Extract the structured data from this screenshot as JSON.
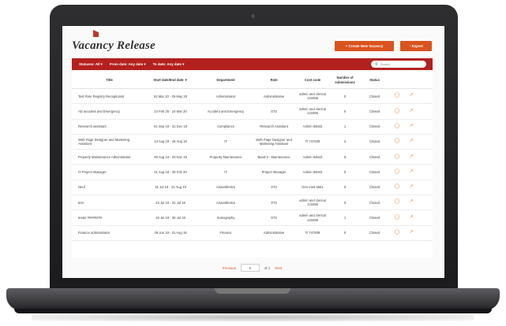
{
  "page": {
    "title": "Vacancy Release",
    "create_button": "+ Create New Vacancy",
    "export_button": "↑ Export"
  },
  "filters": {
    "status": "Statuses: All ▾",
    "from_date": "From date: Any date ▾",
    "to_date": "To date: Any date ▾",
    "search_placeholder": "Search"
  },
  "table": {
    "headers": [
      "Title",
      "Start date/End date ▼",
      "Department",
      "Role",
      "Cost code",
      "Number of submissions",
      "Status"
    ],
    "rows": [
      {
        "title": "Test Role Registry Receptionist",
        "dates": "02 Mar 20 - 29 May 20",
        "department": "Administrator",
        "role": "Administrative",
        "cost_code": "admin and clerical 123456",
        "submissions": "0",
        "status": "Closed"
      },
      {
        "title": "AD accident and Emergency",
        "dates": "24 Feb 20 - 24 Mar 20",
        "department": "Accident and Emergency",
        "role": "ST2",
        "cost_code": "admin and clerical 123456",
        "submissions": "0",
        "status": "Closed"
      },
      {
        "title": "Research assistant",
        "dates": "01 Sep 19 - 31 Dec 19",
        "department": "Compliance",
        "role": "Research Assistant",
        "cost_code": "Admin 84843",
        "submissions": "1",
        "status": "Closed"
      },
      {
        "title": "Web Page Designer and Marketing Assistant",
        "dates": "13 Aug 19 - 26 Aug 19",
        "department": "IT",
        "role": "Web Page Designer and Marketing Assistant",
        "cost_code": "IT 747839",
        "submissions": "2",
        "status": "Closed"
      },
      {
        "title": "Property Maintenance Administrator",
        "dates": "06 Aug 19 - 20 Nov 19",
        "department": "Property Maintenance",
        "role": "Band 5 - Maintenance",
        "cost_code": "Admin 84843",
        "submissions": "6",
        "status": "Closed"
      },
      {
        "title": "IT Project Manager",
        "dates": "01 Aug 19 - 29 Feb 20",
        "department": "IT",
        "role": "Project Manager",
        "cost_code": "Admin 84843",
        "submissions": "0",
        "status": "Closed"
      },
      {
        "title": "Neuf",
        "dates": "31 Jul 19 - 31 Aug 19",
        "department": "Anaesthetics",
        "role": "ST2",
        "cost_code": "Gen med 5561",
        "submissions": "0",
        "status": "Closed"
      },
      {
        "title": "test",
        "dates": "23 Jul 19 - 31 Jul 19",
        "department": "Anaesthetics",
        "role": "ST2",
        "cost_code": "admin and clerical 123456",
        "submissions": "0",
        "status": "Closed"
      },
      {
        "title": "tester ########",
        "dates": "16 Jul 19 - 30 Jul 19",
        "department": "Sonography",
        "role": "ST2",
        "cost_code": "admin and clerical 123456",
        "submissions": "1",
        "status": "Closed"
      },
      {
        "title": "Finance administrator",
        "dates": "26 Jun 19 - 31 Aug 19",
        "department": "Finance",
        "role": "Administrative",
        "cost_code": "IT 747839",
        "submissions": "0",
        "status": "Closed"
      }
    ]
  },
  "pagination": {
    "previous": "Previous",
    "current_page": "1",
    "of_label": "of 1",
    "next": "Next"
  },
  "colors": {
    "accent": "#d9531e",
    "filter_bar": "#b3201e"
  },
  "icons": {
    "row_action_1": "chat-bubble-icon",
    "row_action_2": "external-link-icon",
    "search": "search-icon"
  }
}
